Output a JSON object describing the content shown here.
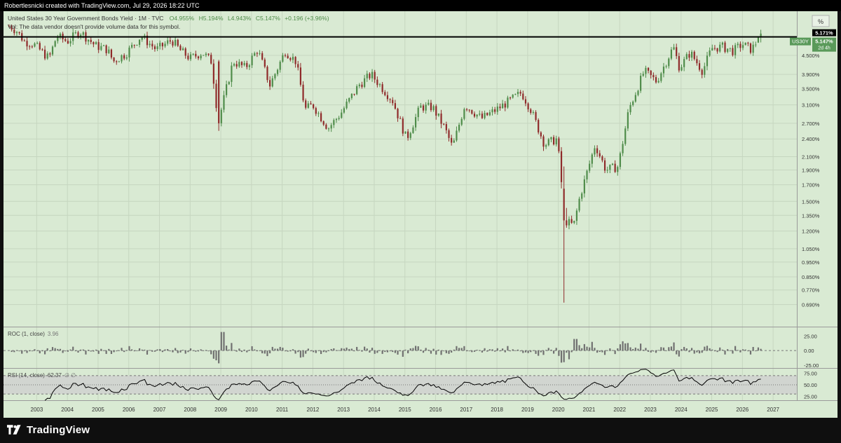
{
  "header": {
    "attribution": "Robertlesnicki created with TradingView.com, Jul 29, 2026 18:22 UTC",
    "symbol_line": "United States 30 Year Government Bonds Yield · 1M · TVC",
    "ohlc": {
      "open": "O4.955%",
      "high": "H5.194%",
      "low": "L4.943%",
      "close": "C5.147%",
      "change": "+0.196 (+3.96%)"
    },
    "volume_note": "Vol: The data vendor doesn't provide volume data for this symbol."
  },
  "scale_button": "%",
  "price_labels": {
    "line_value": "5.171%",
    "ticker": "US30Y",
    "last_value": "5.147%",
    "countdown": "2d 4h"
  },
  "colors": {
    "panel_bg": "#d9ead3",
    "up": "#4f8c4a",
    "down": "#8f2a2a",
    "roc_bar": "#707070",
    "rsi_line": "#000000",
    "rsi_band": "#d0d0d0",
    "line": "#000000",
    "ticker_badge": "#5a9a5a"
  },
  "roc_panel": {
    "label": "ROC (1, close)",
    "value": "3.96",
    "ticks": [
      "25.00",
      "0.00",
      "-25.00"
    ]
  },
  "rsi_panel": {
    "label": "RSI (14, close)",
    "value": "62.37",
    "extra": "∅ ∅",
    "ticks": [
      "75.00",
      "50.00",
      "25.00"
    ]
  },
  "footer": {
    "brand": "TradingView"
  },
  "chart_data": {
    "type": "candlestick",
    "interval": "1M",
    "y_scale": "log",
    "y_ticks": [
      "4.500%",
      "3.900%",
      "3.500%",
      "3.100%",
      "2.700%",
      "2.400%",
      "2.100%",
      "1.900%",
      "1.700%",
      "1.500%",
      "1.350%",
      "1.200%",
      "1.050%",
      "0.950%",
      "0.850%",
      "0.770%",
      "0.690%"
    ],
    "y_tick_values": [
      4.5,
      3.9,
      3.5,
      3.1,
      2.7,
      2.4,
      2.1,
      1.9,
      1.7,
      1.5,
      1.35,
      1.2,
      1.05,
      0.95,
      0.85,
      0.77,
      0.69
    ],
    "ylim": [
      0.6,
      5.3
    ],
    "x_labels": [
      "2003",
      "2004",
      "2005",
      "2006",
      "2007",
      "2008",
      "2009",
      "2010",
      "2011",
      "2012",
      "2013",
      "2014",
      "2015",
      "2016",
      "2017",
      "2018",
      "2019",
      "2020",
      "2021",
      "2022",
      "2023",
      "2024",
      "2025",
      "2026",
      "2027"
    ],
    "xlim": [
      2002.1,
      2027.5
    ],
    "horizontal_line": 5.171,
    "anchors": [
      [
        2002.15,
        5.6
      ],
      [
        2002.35,
        5.4
      ],
      [
        2002.6,
        5.0
      ],
      [
        2002.9,
        4.9
      ],
      [
        2003.4,
        4.4
      ],
      [
        2003.65,
        5.2
      ],
      [
        2004.0,
        5.0
      ],
      [
        2004.4,
        5.4
      ],
      [
        2004.9,
        4.85
      ],
      [
        2005.3,
        4.7
      ],
      [
        2005.5,
        4.3
      ],
      [
        2005.9,
        4.55
      ],
      [
        2006.4,
        5.2
      ],
      [
        2006.9,
        4.7
      ],
      [
        2007.4,
        5.05
      ],
      [
        2007.7,
        4.65
      ],
      [
        2008.0,
        4.4
      ],
      [
        2008.4,
        4.6
      ],
      [
        2008.7,
        4.3
      ],
      [
        2008.92,
        2.7
      ],
      [
        2009.05,
        3.1
      ],
      [
        2009.4,
        4.3
      ],
      [
        2009.8,
        4.1
      ],
      [
        2010.2,
        4.7
      ],
      [
        2010.6,
        3.6
      ],
      [
        2011.1,
        4.65
      ],
      [
        2011.45,
        4.3
      ],
      [
        2011.75,
        3.0
      ],
      [
        2012.0,
        3.1
      ],
      [
        2012.5,
        2.6
      ],
      [
        2012.9,
        2.9
      ],
      [
        2013.5,
        3.6
      ],
      [
        2013.9,
        3.9
      ],
      [
        2014.6,
        3.2
      ],
      [
        2015.05,
        2.4
      ],
      [
        2015.5,
        3.05
      ],
      [
        2015.9,
        3.05
      ],
      [
        2016.3,
        2.6
      ],
      [
        2016.55,
        2.25
      ],
      [
        2016.95,
        3.1
      ],
      [
        2017.5,
        2.8
      ],
      [
        2018.0,
        3.0
      ],
      [
        2018.8,
        3.4
      ],
      [
        2019.1,
        3.0
      ],
      [
        2019.55,
        2.3
      ],
      [
        2019.95,
        2.4
      ],
      [
        2020.05,
        2.0
      ],
      [
        2020.2,
        1.3
      ],
      [
        2020.5,
        1.25
      ],
      [
        2020.7,
        1.55
      ],
      [
        2021.2,
        2.3
      ],
      [
        2021.55,
        1.9
      ],
      [
        2021.95,
        1.95
      ],
      [
        2022.3,
        3.0
      ],
      [
        2022.8,
        4.0
      ],
      [
        2023.2,
        3.7
      ],
      [
        2023.75,
        4.8
      ],
      [
        2023.95,
        4.1
      ],
      [
        2024.3,
        4.6
      ],
      [
        2024.7,
        4.0
      ],
      [
        2025.0,
        4.75
      ],
      [
        2025.35,
        4.8
      ],
      [
        2025.7,
        4.65
      ],
      [
        2026.0,
        4.9
      ],
      [
        2026.3,
        4.7
      ],
      [
        2026.55,
        5.15
      ]
    ],
    "notable_candles": [
      {
        "x": 2008.92,
        "open": 4.3,
        "close": 2.7,
        "high": 4.35,
        "low": 2.55
      },
      {
        "x": 2020.2,
        "open": 1.65,
        "close": 1.3,
        "high": 1.95,
        "low": 0.7
      },
      {
        "x": 2026.55,
        "open": 4.955,
        "close": 5.147,
        "high": 5.194,
        "low": 4.943
      }
    ],
    "roc": {
      "ylim": [
        -30,
        40
      ],
      "large": [
        [
          2008.92,
          -22
        ],
        [
          2009.05,
          32
        ],
        [
          2020.2,
          -20
        ],
        [
          2020.35,
          -15
        ],
        [
          2020.55,
          20
        ],
        [
          2021.1,
          15
        ],
        [
          2022.1,
          16
        ],
        [
          2022.7,
          12
        ],
        [
          2023.75,
          14
        ]
      ]
    },
    "rsi": {
      "ylim": [
        15,
        85
      ],
      "levels": [
        70,
        50,
        30
      ],
      "last": 62.37
    }
  }
}
